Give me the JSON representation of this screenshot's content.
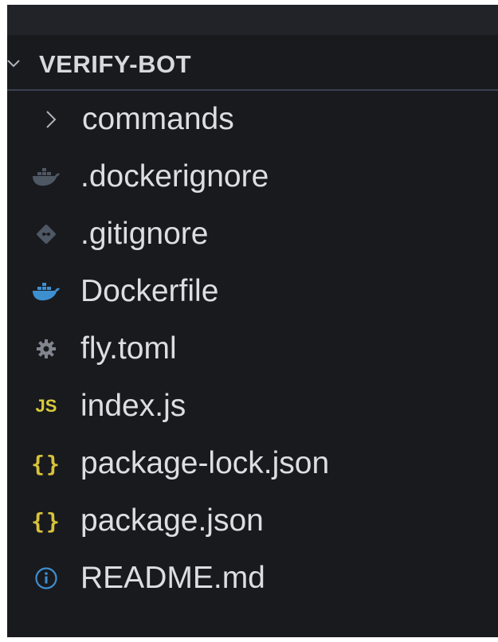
{
  "explorer": {
    "project_title": "VERIFY-BOT",
    "items": [
      {
        "label": "commands",
        "icon": "chevron-right-icon",
        "kind": "folder"
      },
      {
        "label": ".dockerignore",
        "icon": "docker-icon",
        "kind": "file",
        "icon_color": "#5a6470"
      },
      {
        "label": ".gitignore",
        "icon": "git-icon",
        "kind": "file",
        "icon_color": "#5a6470"
      },
      {
        "label": "Dockerfile",
        "icon": "docker-icon",
        "kind": "file",
        "icon_color": "#3e8fd0"
      },
      {
        "label": "fly.toml",
        "icon": "gear-icon",
        "kind": "file",
        "icon_color": "#8a8f97"
      },
      {
        "label": "index.js",
        "icon": "js-icon",
        "icon_text": "JS",
        "kind": "file",
        "icon_color": "#d8cb3a"
      },
      {
        "label": "package-lock.json",
        "icon": "json-braces-icon",
        "icon_text": "{}",
        "kind": "file",
        "icon_color": "#d8c23a"
      },
      {
        "label": "package.json",
        "icon": "json-braces-icon",
        "icon_text": "{}",
        "kind": "file",
        "icon_color": "#d8c23a"
      },
      {
        "label": "README.md",
        "icon": "info-icon",
        "kind": "file",
        "icon_color": "#3e8fd0"
      }
    ]
  },
  "colors": {
    "background": "#191a1e",
    "header_divider": "#3b4152",
    "text": "#dcdee3"
  }
}
